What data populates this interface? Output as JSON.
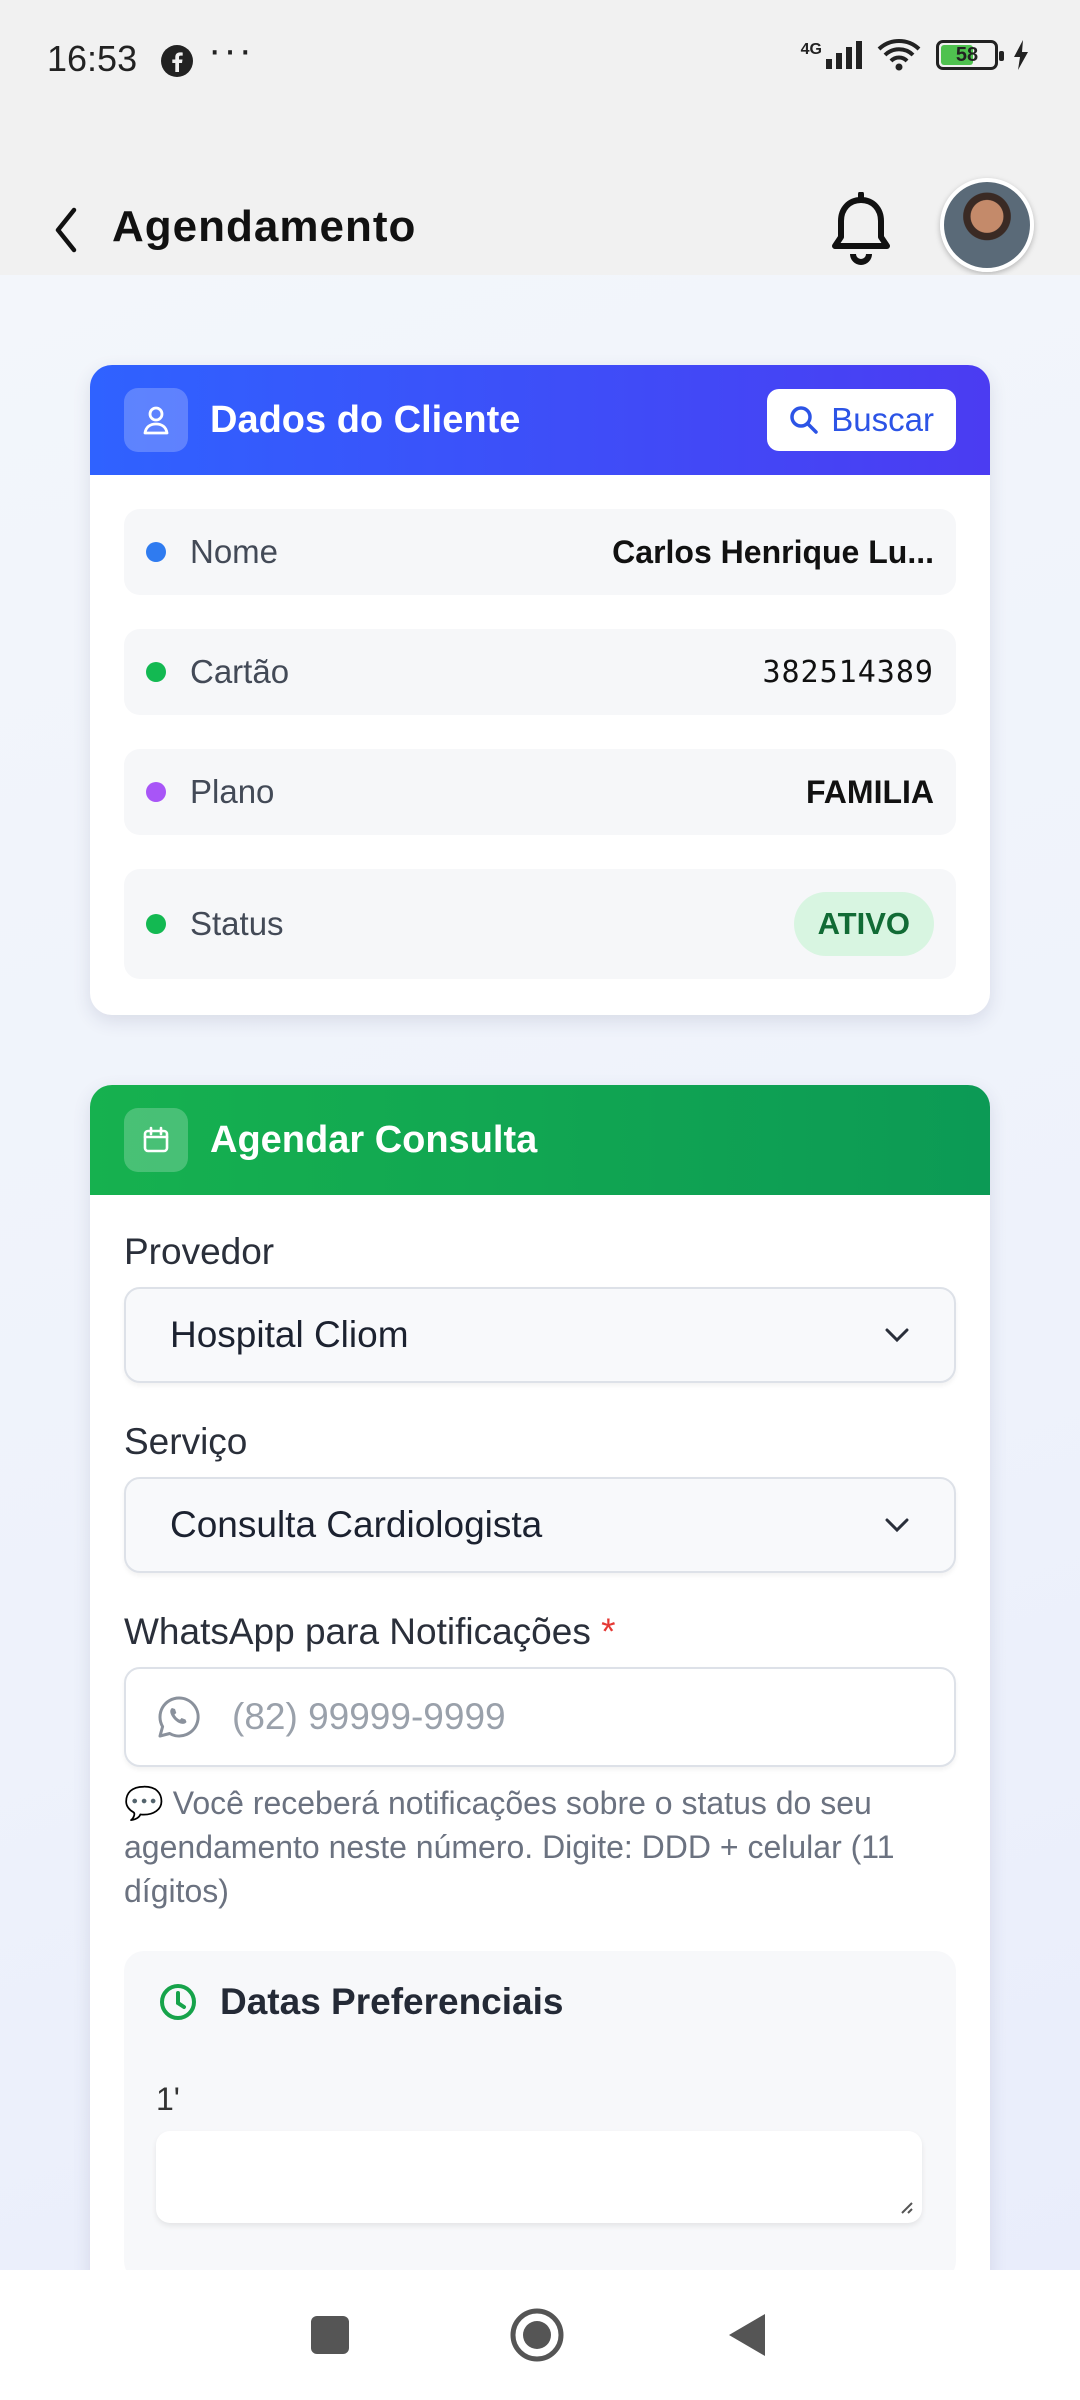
{
  "status_bar": {
    "time": "16:53",
    "network": "4G",
    "battery": "58"
  },
  "header": {
    "title": "Agendamento"
  },
  "cliente_card": {
    "title": "Dados do Cliente",
    "buscar_label": "Buscar",
    "rows": [
      {
        "label": "Nome",
        "value": "Carlos Henrique Lu...",
        "dot_color": "#2f7bf0"
      },
      {
        "label": "Cartão",
        "value": "382514389",
        "dot_color": "#13b952"
      },
      {
        "label": "Plano",
        "value": "FAMILIA",
        "dot_color": "#a855f7"
      },
      {
        "label": "Status",
        "value": "ATIVO",
        "dot_color": "#13b952"
      }
    ]
  },
  "agendar_card": {
    "title": "Agendar Consulta",
    "provedor_label": "Provedor",
    "provedor_value": "Hospital Cliom",
    "servico_label": "Serviço",
    "servico_value": "Consulta Cardiologista",
    "whatsapp_label": "WhatsApp para Notificações",
    "whatsapp_required": "*",
    "whatsapp_placeholder": "(82) 99999-9999",
    "whatsapp_hint": "💬 Você receberá notificações sobre o status do seu agendamento neste número. Digite: DDD + celular (11 dígitos)",
    "datas_title": "Datas Preferenciais",
    "datas_partial": "1'"
  },
  "bottom_nav": {
    "items": [
      "home-icon",
      "search-icon",
      "building-icon",
      "calendar-clock-icon"
    ],
    "active_color": "#35b6ef"
  }
}
